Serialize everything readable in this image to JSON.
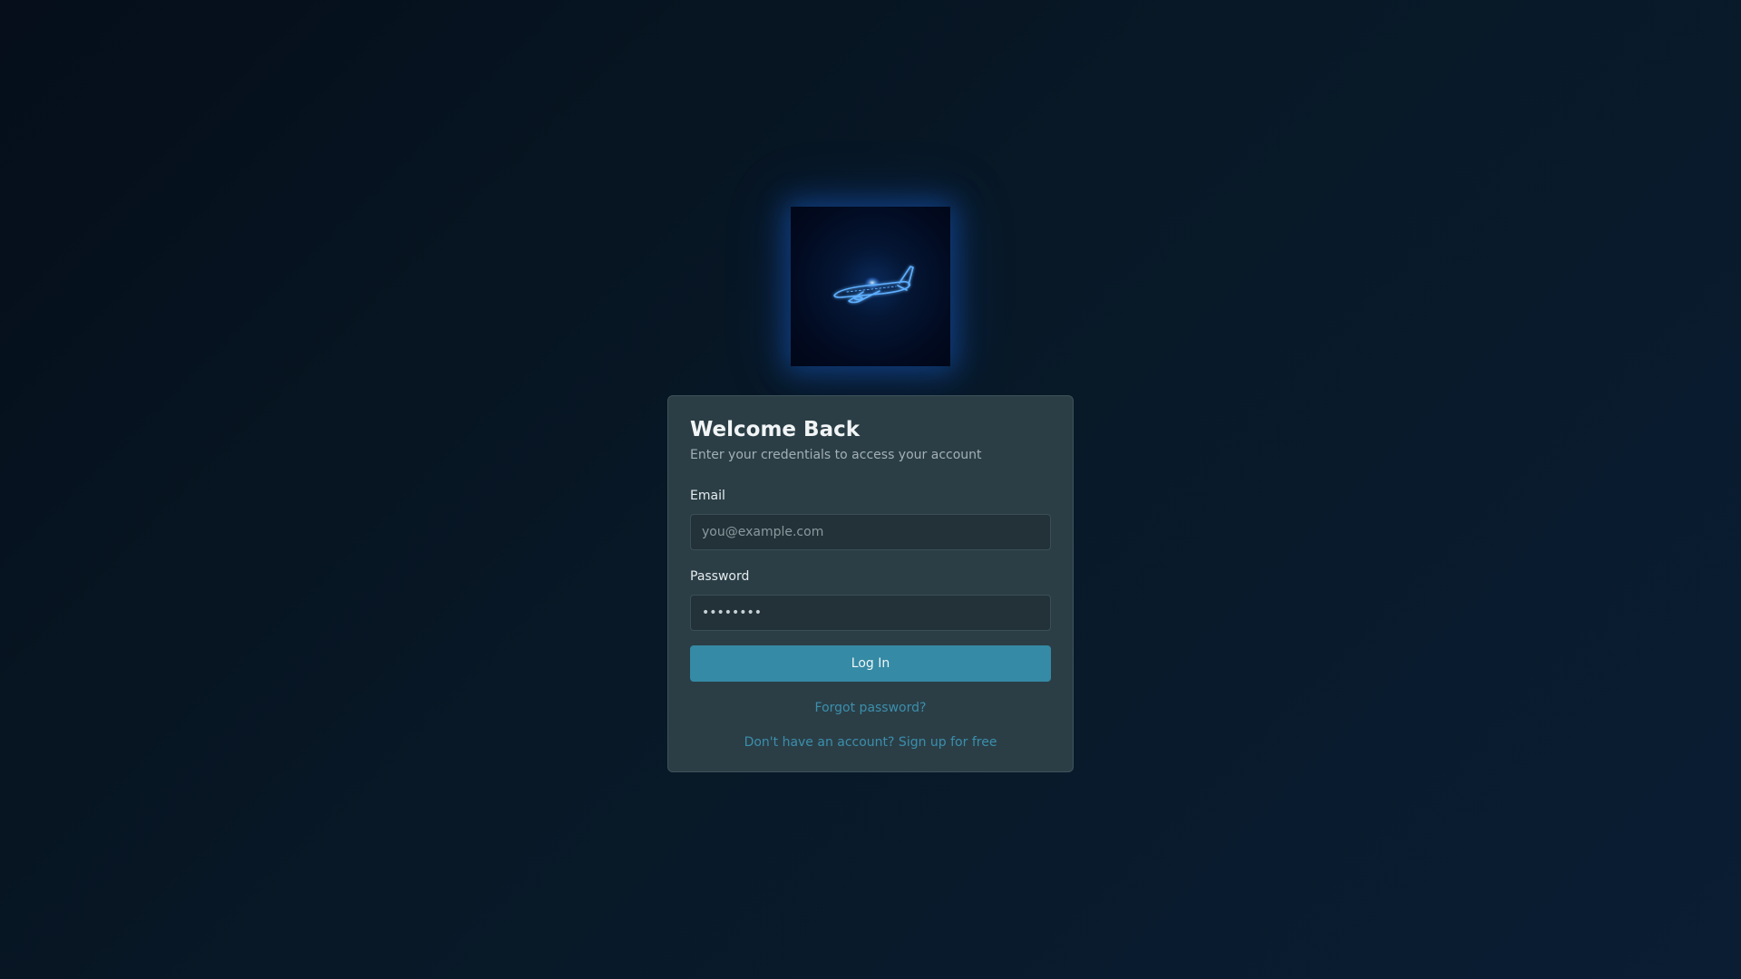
{
  "logo": {
    "icon": "airplane-icon",
    "glow_color": "#2f8cff"
  },
  "login": {
    "title": "Welcome Back",
    "subtitle": "Enter your credentials to access your account",
    "email_label": "Email",
    "email_placeholder": "you@example.com",
    "password_label": "Password",
    "password_value": "••••••••",
    "submit_label": "Log In",
    "forgot_link": "Forgot password?",
    "signup_link": "Don't have an account? Sign up for free"
  },
  "colors": {
    "accent": "#358aa5",
    "link": "#3b8fad",
    "card_bg": "#2b3e46",
    "page_bg": "#07131f"
  }
}
